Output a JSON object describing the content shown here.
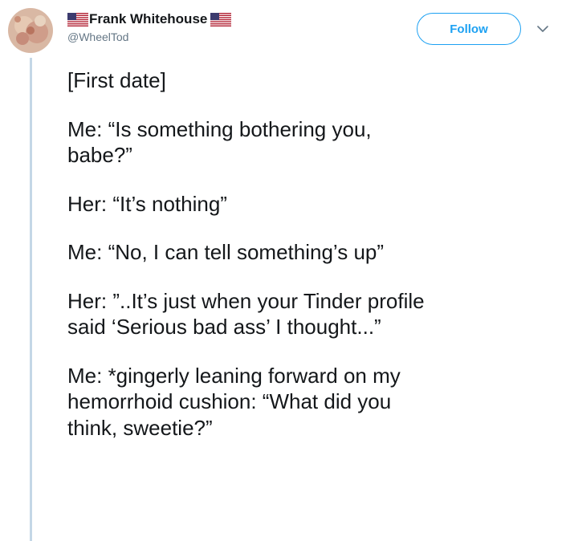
{
  "tweet": {
    "author": {
      "display_name": "Frank Whitehouse",
      "handle": "@WheelTod",
      "avatar_icon": "avatar-image",
      "flag_icon": "us-flag-icon"
    },
    "follow_label": "Follow",
    "menu_icon": "chevron-down-icon",
    "paragraphs": [
      "[First date]",
      "Me: “Is something bothering you,\nbabe?”",
      "Her: “It’s nothing”",
      "Me: “No, I can tell something’s up”",
      "Her: ”..It’s just when your Tinder profile\nsaid ‘Serious bad ass’ I thought...”",
      "Me: *gingerly leaning forward on my\nhemorrhoid cushion: “What did you\nthink, sweetie?”"
    ]
  },
  "colors": {
    "accent": "#1da1f2",
    "text": "#14171a",
    "secondary_text": "#657786",
    "thread_line": "#c4d7e6"
  }
}
